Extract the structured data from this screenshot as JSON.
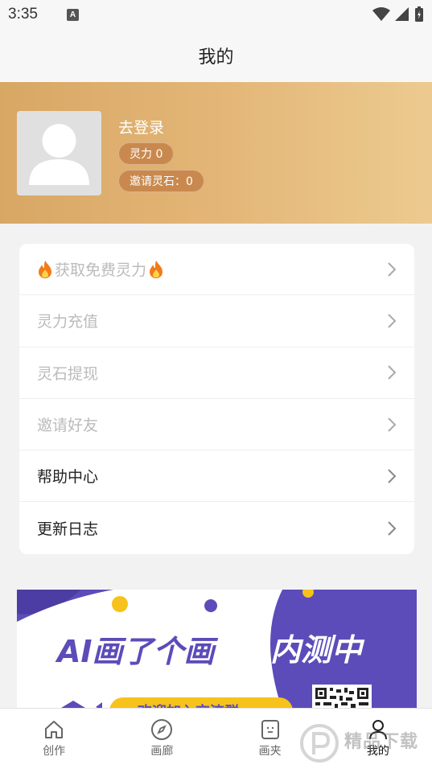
{
  "status_bar": {
    "time": "3:35",
    "notification_letter": "A"
  },
  "header": {
    "title": "我的"
  },
  "profile": {
    "login_label": "去登录",
    "spirit_power": "灵力 0",
    "invite_stones": "邀请灵石：0"
  },
  "menu": {
    "items": [
      {
        "label": "获取免费灵力",
        "muted": true,
        "flame": true
      },
      {
        "label": "灵力充值",
        "muted": true
      },
      {
        "label": "灵石提现",
        "muted": true
      },
      {
        "label": "邀请好友",
        "muted": true
      },
      {
        "label": "帮助中心",
        "muted": false
      },
      {
        "label": "更新日志",
        "muted": false
      }
    ]
  },
  "banner": {
    "app_name": "AI画了个画",
    "beta_label": "内测中",
    "cta_label": "欢迎加入交流群"
  },
  "bottom_nav": {
    "items": [
      {
        "label": "创作",
        "icon": "home-icon"
      },
      {
        "label": "画廊",
        "icon": "compass-icon"
      },
      {
        "label": "画夹",
        "icon": "folder-icon"
      },
      {
        "label": "我的",
        "icon": "user-icon",
        "active": true
      }
    ]
  },
  "watermark": {
    "text": "精品下载"
  },
  "colors": {
    "profile_gradient_start": "#d8a764",
    "profile_gradient_end": "#ecca8f",
    "banner_purple": "#5c4cb9",
    "banner_yellow": "#f6c21b"
  }
}
